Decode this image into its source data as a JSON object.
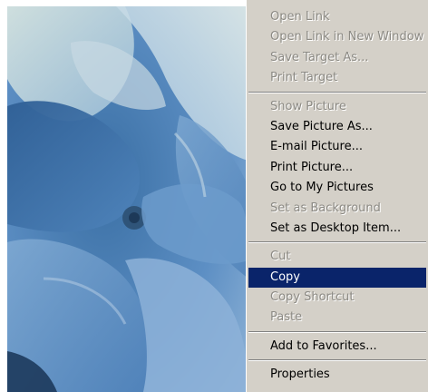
{
  "context_menu": {
    "groups": [
      {
        "items": [
          {
            "label": "Open Link",
            "enabled": false
          },
          {
            "label": "Open Link in New Window",
            "enabled": false
          },
          {
            "label": "Save Target As...",
            "enabled": false
          },
          {
            "label": "Print Target",
            "enabled": false
          }
        ]
      },
      {
        "items": [
          {
            "label": "Show Picture",
            "enabled": false
          },
          {
            "label": "Save Picture As...",
            "enabled": true
          },
          {
            "label": "E-mail Picture...",
            "enabled": true
          },
          {
            "label": "Print Picture...",
            "enabled": true
          },
          {
            "label": "Go to My Pictures",
            "enabled": true
          },
          {
            "label": "Set as Background",
            "enabled": false
          },
          {
            "label": "Set as Desktop Item...",
            "enabled": true
          }
        ]
      },
      {
        "items": [
          {
            "label": "Cut",
            "enabled": false
          },
          {
            "label": "Copy",
            "enabled": true,
            "highlighted": true
          },
          {
            "label": "Copy Shortcut",
            "enabled": false
          },
          {
            "label": "Paste",
            "enabled": false
          }
        ]
      },
      {
        "items": [
          {
            "label": "Add to Favorites...",
            "enabled": true
          }
        ]
      },
      {
        "items": [
          {
            "label": "Properties",
            "enabled": true
          }
        ]
      }
    ]
  },
  "colors": {
    "menu_background": "#d4d0c8",
    "highlight": "#0a246a",
    "highlight_text": "#ffffff",
    "disabled_text": "#8c8a84",
    "photo_blue": "#5f8fc0"
  }
}
